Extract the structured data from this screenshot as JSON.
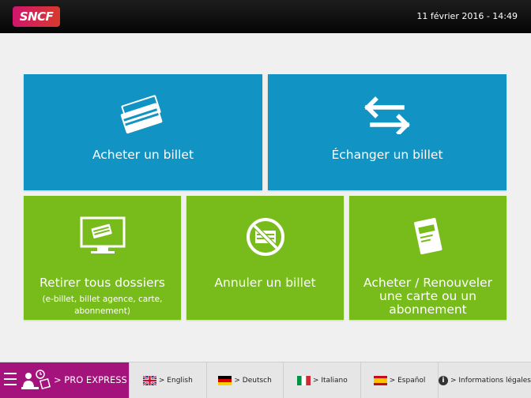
{
  "header": {
    "logo_text": "SNCF",
    "datetime": "11 février 2016 - 14:49"
  },
  "tiles": [
    {
      "label": "Acheter un billet",
      "icon": "tickets-icon",
      "color": "#1193c3"
    },
    {
      "label": "Échanger un billet",
      "icon": "exchange-arrows-icon",
      "color": "#1193c3"
    },
    {
      "label": "Retirer tous dossiers",
      "sub": "(e-billet, billet agence, carte, abonnement)",
      "icon": "monitor-ticket-icon",
      "color": "#78bc1c"
    },
    {
      "label": "Annuler un billet",
      "icon": "cancel-ticket-icon",
      "color": "#78bc1c"
    },
    {
      "label": "Acheter / Renouveler une carte ou un abonnement",
      "icon": "card-icon",
      "color": "#78bc1c"
    }
  ],
  "footer": {
    "pro_label": "> PRO EXPRESS",
    "pro_color": "#a4127c",
    "languages": [
      {
        "label": "> English",
        "flag": "uk-flag-icon"
      },
      {
        "label": "> Deutsch",
        "flag": "germany-flag-icon"
      },
      {
        "label": "> Italiano",
        "flag": "italy-flag-icon"
      },
      {
        "label": "> Español",
        "flag": "spain-flag-icon"
      }
    ],
    "info_label": "> Informations légales",
    "info_icon": "info-icon"
  }
}
